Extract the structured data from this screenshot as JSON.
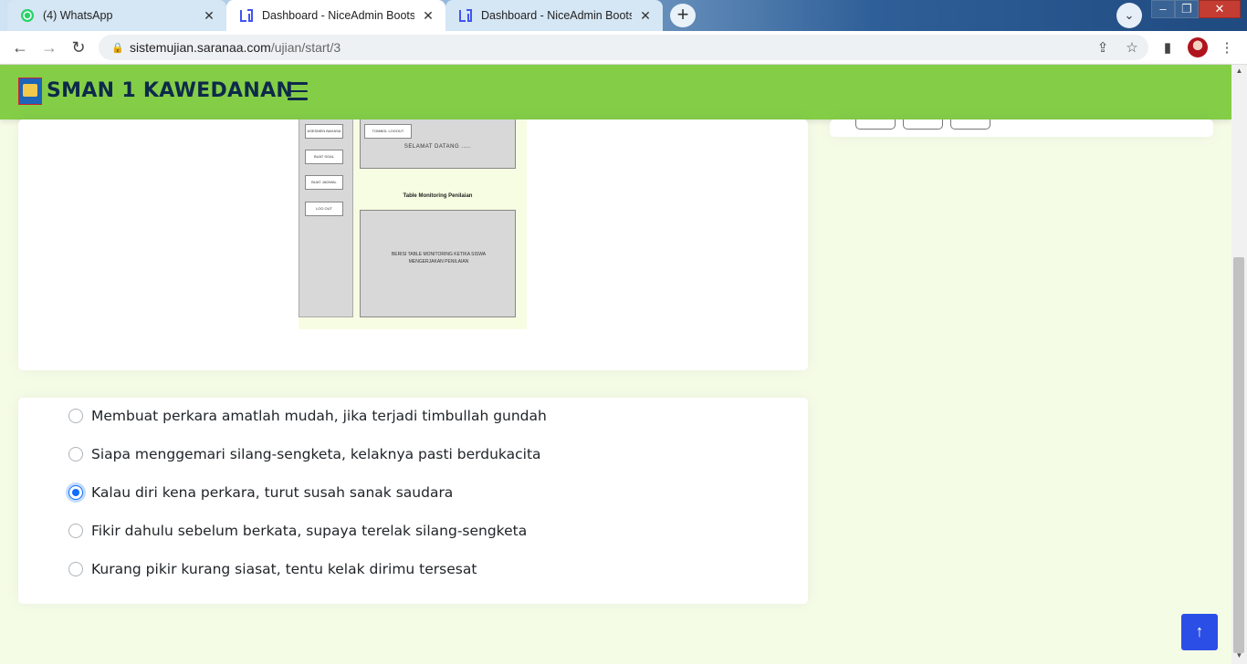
{
  "browser": {
    "tabs": [
      {
        "title": "(4) WhatsApp",
        "active": false,
        "icon": "whatsapp-icon"
      },
      {
        "title": "Dashboard - NiceAdmin Bootstrap",
        "active": true,
        "icon": "niceadmin-icon"
      },
      {
        "title": "Dashboard - NiceAdmin Bootstrap",
        "active": false,
        "icon": "niceadmin-icon"
      }
    ],
    "close_glyph": "✕",
    "new_tab_glyph": "+",
    "url_host": "sistemujian.saranaa.com",
    "url_path": "/ujian/start/3"
  },
  "header": {
    "brand": "SMAN 1 KAWEDANAN",
    "accent": "#84ce47"
  },
  "mockup": {
    "sidebar_buttons": [
      "ASESMEN BAHASA INDONESIA",
      "BUAT SOAL",
      "BUAT JADWAL",
      "LOG OUT"
    ],
    "welcome_chip": "TOMBOL LOGOUT",
    "welcome_text": "SELAMAT DATANG .....",
    "table_title": "Table Monitoring Penilaian",
    "table_text": "BERISI TABLE MONITORING KETIKA SISWA MENGERJAKAN PENILAIAN"
  },
  "answers": {
    "options": [
      {
        "label": "Membuat perkara amatlah mudah, jika terjadi timbullah gundah",
        "checked": false
      },
      {
        "label": "Siapa menggemari silang-sengketa, kelaknya pasti berdukacita",
        "checked": false
      },
      {
        "label": "Kalau diri kena perkara, turut susah sanak saudara",
        "checked": true
      },
      {
        "label": "Fikir dahulu sebelum berkata, supaya terelak silang-sengketa",
        "checked": false
      },
      {
        "label": "Kurang pikir kurang siasat, tentu kelak dirimu tersesat",
        "checked": false
      }
    ],
    "selected_color": "#0d6efd"
  },
  "back_to_top_glyph": "↑"
}
